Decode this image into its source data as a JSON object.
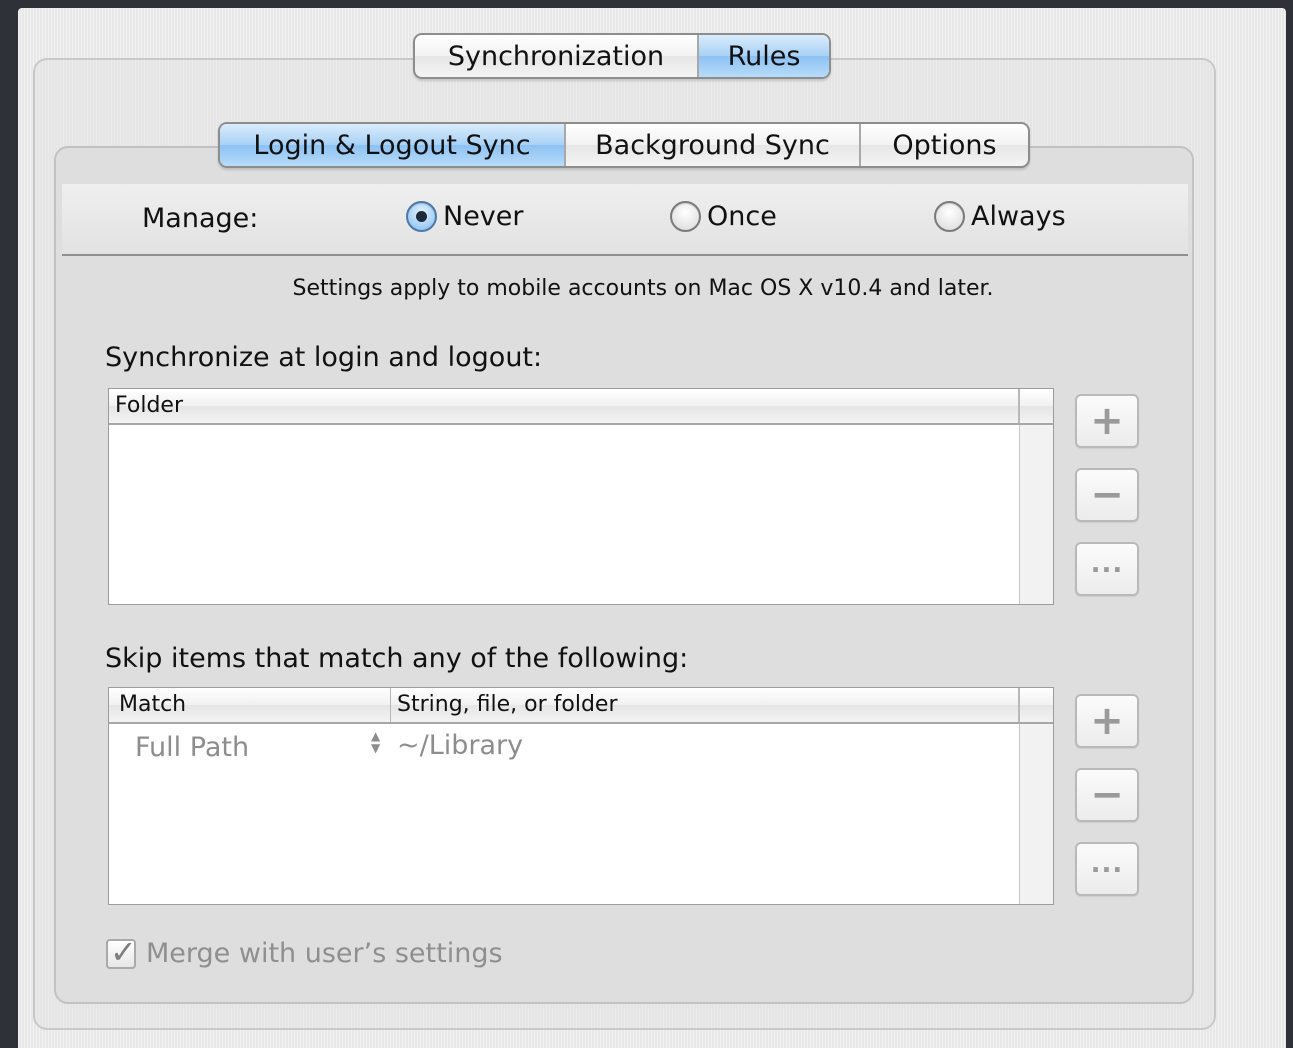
{
  "top_tabs": [
    {
      "label": "Synchronization",
      "active": false
    },
    {
      "label": "Rules",
      "active": true
    }
  ],
  "sub_tabs": [
    {
      "label": "Login & Logout Sync",
      "active": true
    },
    {
      "label": "Background Sync",
      "active": false
    },
    {
      "label": "Options",
      "active": false
    }
  ],
  "manage": {
    "label": "Manage:",
    "options": [
      {
        "label": "Never",
        "selected": true
      },
      {
        "label": "Once",
        "selected": false
      },
      {
        "label": "Always",
        "selected": false
      }
    ]
  },
  "notice": "Settings apply to mobile accounts on Mac OS X v10.4 and later.",
  "sync_section": {
    "title": "Synchronize at login and logout:",
    "columns": [
      "Folder"
    ],
    "rows": []
  },
  "skip_section": {
    "title": "Skip items that match any of the following:",
    "columns": [
      "Match",
      "String, file, or folder"
    ],
    "rows": [
      {
        "match": "Full Path",
        "value": "~/Library"
      }
    ]
  },
  "buttons": {
    "add": "+",
    "remove": "−",
    "edit": "..."
  },
  "merge_checkbox": {
    "label": "Merge with user’s settings",
    "checked": true,
    "enabled": false
  }
}
